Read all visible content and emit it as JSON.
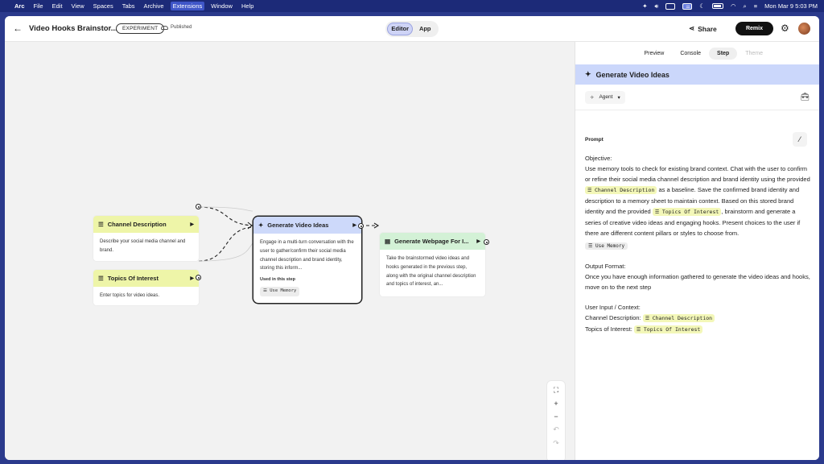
{
  "menubar": {
    "apple": "",
    "items": [
      "Arc",
      "File",
      "Edit",
      "View",
      "Spaces",
      "Tabs",
      "Archive",
      "Extensions",
      "Window",
      "Help"
    ],
    "clock": "Mon Mar 9  5:03 PM"
  },
  "topbar": {
    "back": "←",
    "title": "Video Hooks Brainstor...",
    "badge": "EXPERIMENT",
    "published": "Published",
    "mode_editor": "Editor",
    "mode_app": "App",
    "share": "Share",
    "remix": "Remix"
  },
  "nodes": {
    "channel": {
      "title": "Channel Description",
      "body": "Describe your social media channel and brand."
    },
    "topics": {
      "title": "Topics Of Interest",
      "body": "Enter topics for video ideas."
    },
    "generate": {
      "title": "Generate Video Ideas",
      "body": "Engage in a multi-turn conversation with the user to gather/confirm their social media channel description and brand identity, storing this inform...",
      "used_label": "Used in this step",
      "memory_chip": "Use Memory"
    },
    "webpage": {
      "title": "Generate Webpage For I...",
      "body": "Take the brainstormed video ideas and hooks generated in the previous step, along with the original channel description and topics of interest, an..."
    }
  },
  "zoom": {
    "fit": "⛶",
    "plus": "+",
    "minus": "−",
    "undo": "↶",
    "redo": "↷"
  },
  "panel": {
    "tabs": [
      "Preview",
      "Console",
      "Step",
      "Theme"
    ],
    "active_tab": "Step",
    "header": "Generate Video Ideas",
    "agent": "Agent",
    "prompt_label": "Prompt",
    "objective_label": "Objective:",
    "p1": "Use memory tools to check for existing brand context. Chat with the user to confirm or refine their social media channel description and brand identity using the provided",
    "chip_channel": "Channel Description",
    "p2": "as a baseline. Save the confirmed brand identity and description to a memory sheet to maintain context. Based on this stored brand identity and the provided",
    "chip_topics": "Topics Of Interest",
    "p3": ", brainstorm and generate a series of creative video ideas and engaging hooks. Present choices to the user if there are different content pillars or styles to choose from.",
    "chip_memory": "Use Memory",
    "output_label": "Output Format:",
    "output_text": "Once you have enough information gathered to generate the video ideas and hooks, move on to the next step",
    "input_label": "User Input / Context:",
    "input_channel": "Channel Description:",
    "input_topics": "Topics of Interest:"
  }
}
